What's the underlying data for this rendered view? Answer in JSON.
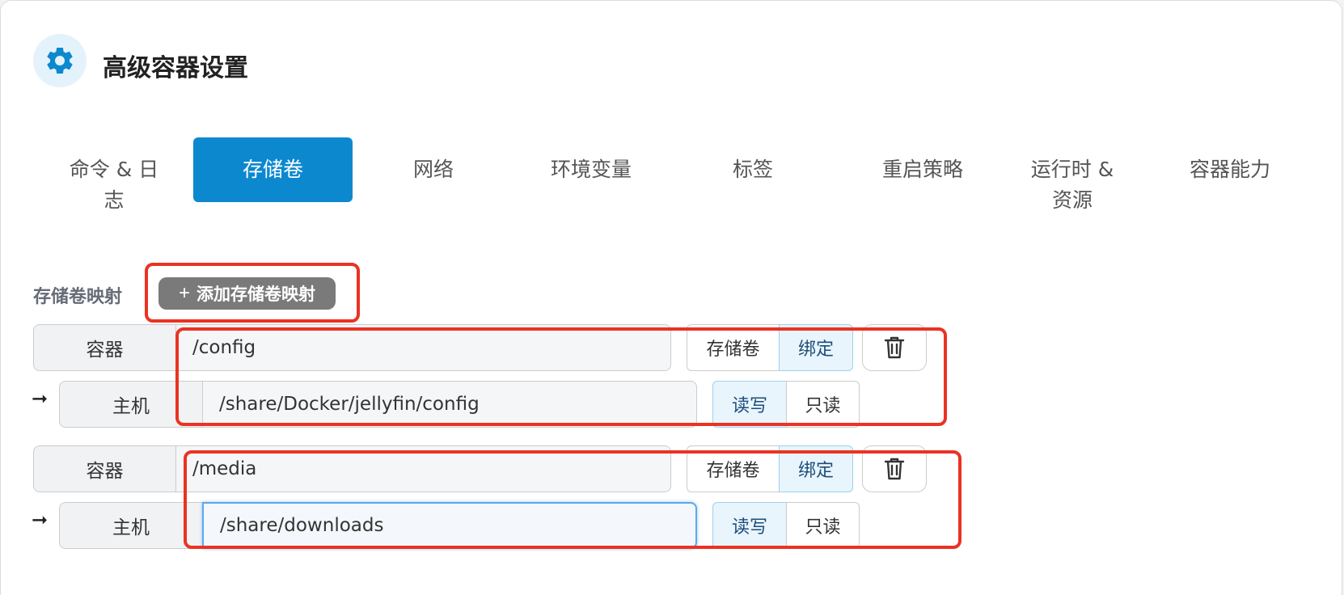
{
  "header": {
    "title": "高级容器设置",
    "icon": "gear-icon"
  },
  "tabs": [
    {
      "label": "命令 & 日\n志",
      "active": false
    },
    {
      "label": "存储卷",
      "active": true
    },
    {
      "label": "网络",
      "active": false
    },
    {
      "label": "环境变量",
      "active": false
    },
    {
      "label": "标签",
      "active": false
    },
    {
      "label": "重启策略",
      "active": false
    },
    {
      "label": "运行时 &\n资源",
      "active": false
    },
    {
      "label": "容器能力",
      "active": false
    }
  ],
  "volumes": {
    "section_label": "存储卷映射",
    "add_button": "添加存储卷映射",
    "add_icon": "+",
    "mappings": [
      {
        "container_label": "容器",
        "container_path": "/config",
        "type_options": [
          "存储卷",
          "绑定"
        ],
        "type_selected": "绑定",
        "host_label": "主机",
        "host_path": "/share/Docker/jellyfin/config",
        "mode_options": [
          "读写",
          "只读"
        ],
        "mode_selected": "读写"
      },
      {
        "container_label": "容器",
        "container_path": "/media",
        "type_options": [
          "存储卷",
          "绑定"
        ],
        "type_selected": "绑定",
        "host_label": "主机",
        "host_path": "/share/downloads",
        "mode_options": [
          "读写",
          "只读"
        ],
        "mode_selected": "读写"
      }
    ]
  },
  "colors": {
    "accent": "#0c88cf",
    "highlight": "#ea3323",
    "add_button_bg": "#7a7a7a"
  }
}
